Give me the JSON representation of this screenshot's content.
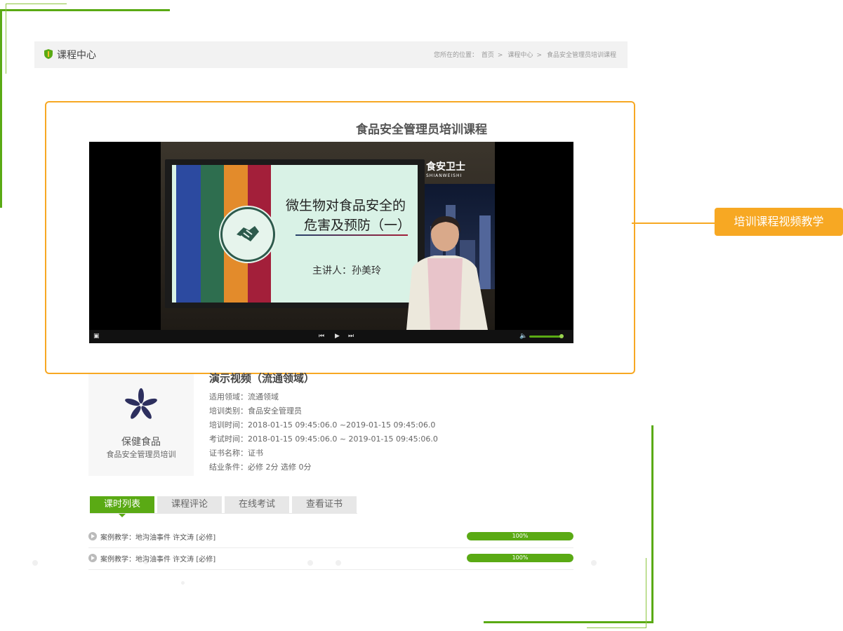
{
  "header": {
    "title": "课程中心",
    "breadcrumb": {
      "prefix": "您所在的位置：",
      "items": [
        "首页",
        "课程中心",
        "食品安全管理员培训课程"
      ]
    }
  },
  "course": {
    "title": "食品安全管理员培训课程"
  },
  "video": {
    "slide_line1": "微生物对食品安全的",
    "slide_line2": "危害及预防（一）",
    "slide_speaker": "主讲人：孙美玲",
    "watermark": "食安卫士",
    "watermark_sub": "SHIANWEISHI"
  },
  "callout": {
    "label": "培训课程视频教学"
  },
  "card": {
    "title": "保健食品",
    "subtitle": "食品安全管理员培训"
  },
  "info": {
    "title": "演示视频（流通领域）",
    "rows": [
      "适用领域：流通领域",
      "培训类别：食品安全管理员",
      "培训时间：2018-01-15 09:45:06.0 ~2019-01-15 09:45:06.0",
      "考试时间：2018-01-15 09:45:06.0 ~ 2019-01-15 09:45:06.0",
      "证书名称：证书",
      "结业条件：必修 2分 选修 0分"
    ]
  },
  "tabs": [
    "课时列表",
    "课程评论",
    "在线考试",
    "查看证书"
  ],
  "lessons": [
    {
      "text": "案例教学：地沟油事件  许文涛  [必修]",
      "progress": 100,
      "progress_label": "100%"
    },
    {
      "text": "案例教学：地沟油事件  许文涛  [必修]",
      "progress": 100,
      "progress_label": "100%"
    }
  ],
  "colors": {
    "accent_green": "#5aaa14",
    "accent_orange": "#f7a823"
  }
}
